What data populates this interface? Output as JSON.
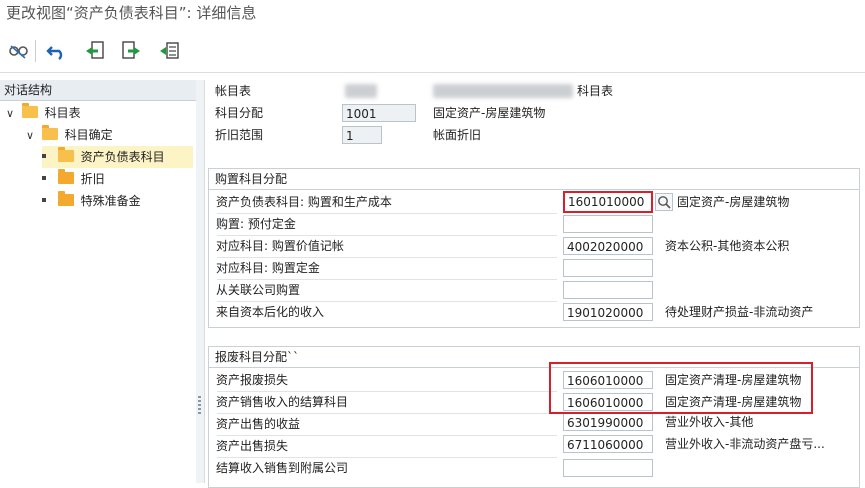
{
  "window_title": "更改视图“资产负债表科目”: 详细信息",
  "toolbar": {
    "icons": [
      "glasses-icon",
      "undo-icon",
      "previous-entry-icon",
      "next-entry-icon",
      "select-all-icon"
    ]
  },
  "tree": {
    "header": "对话结构",
    "items": [
      {
        "label": "科目表",
        "level": 0,
        "expanded": true
      },
      {
        "label": "科目确定",
        "level": 1,
        "expanded": true
      },
      {
        "label": "资产负债表科目",
        "level": 2,
        "selected": true
      },
      {
        "label": "折旧",
        "level": 2
      },
      {
        "label": "特殊准备金",
        "level": 2
      }
    ]
  },
  "header": {
    "chart_of_accounts_label": "帐目表",
    "chart_of_accounts_desc_suffix": "科目表",
    "account_allocation_label": "科目分配",
    "account_allocation_value": "1001",
    "account_allocation_desc": "固定资产-房屋建筑物",
    "depr_area_label": "折旧范围",
    "depr_area_value": "1",
    "depr_area_desc": "帐面折旧"
  },
  "acquisition": {
    "title": "购置科目分配",
    "rows": [
      {
        "label": "资产负债表科目: 购置和生产成本",
        "value": "1601010000",
        "desc": "固定资产-房屋建筑物"
      },
      {
        "label": "购置: 预付定金",
        "value": "",
        "desc": ""
      },
      {
        "label": "对应科目: 购置价值记帐",
        "value": "4002020000",
        "desc": "资本公积-其他资本公积"
      },
      {
        "label": "对应科目: 购置定金",
        "value": "",
        "desc": ""
      },
      {
        "label": "从关联公司购置",
        "value": "",
        "desc": ""
      },
      {
        "label": "来自资本后化的收入",
        "value": "1901020000",
        "desc": "待处理财产损益-非流动资产"
      }
    ]
  },
  "retirement": {
    "title": "报废科目分配``",
    "rows": [
      {
        "label": "资产报废损失",
        "value": "1606010000",
        "desc": "固定资产清理-房屋建筑物"
      },
      {
        "label": "资产销售收入的结算科目",
        "value": "1606010000",
        "desc": "固定资产清理-房屋建筑物"
      },
      {
        "label": "资产出售的收益",
        "value": "6301990000",
        "desc": "营业外收入-其他"
      },
      {
        "label": "资产出售损失",
        "value": "6711060000",
        "desc": "营业外收入-非流动资产盘亏..."
      },
      {
        "label": "结算收入销售到附属公司",
        "value": "",
        "desc": ""
      }
    ]
  },
  "colors": {
    "highlight_border": "#d9202a",
    "selected_row": "#fcf4c5",
    "folder": "#f3a92e"
  }
}
